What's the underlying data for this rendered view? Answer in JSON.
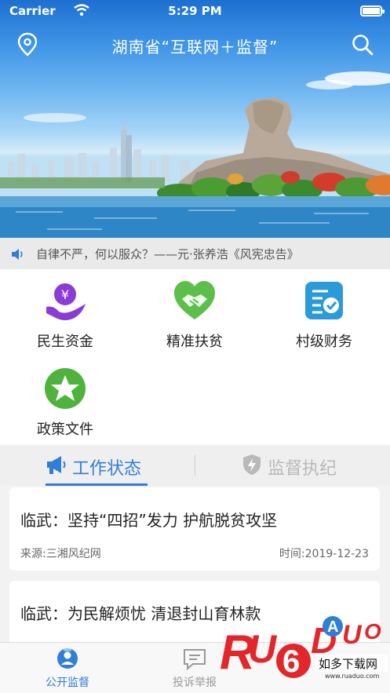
{
  "status_bar": {
    "carrier": "Carrier",
    "time": "5:29 PM"
  },
  "header": {
    "title": "湖南省“互联网＋监督”"
  },
  "notice": {
    "text": "自律不严，何以服众？——元·张养浩《风宪忠告》"
  },
  "services": [
    {
      "label": "民生资金",
      "icon": "money-hand-icon"
    },
    {
      "label": "精准扶贫",
      "icon": "heart-handshake-icon"
    },
    {
      "label": "村级财务",
      "icon": "document-check-icon"
    },
    {
      "label": "政策文件",
      "icon": "star-badge-icon"
    }
  ],
  "tabs": [
    {
      "label": "工作状态",
      "icon": "megaphone-icon",
      "active": true
    },
    {
      "label": "监督执纪",
      "icon": "shield-bolt-icon",
      "active": false
    }
  ],
  "news": [
    {
      "title": "临武：坚持“四招”发力 护航脱贫攻坚",
      "source": "来源:三湘风纪网",
      "time": "时间:2019-12-23"
    },
    {
      "title": "临武：为民解烦忧 清退封山育林款"
    }
  ],
  "bottom_tabs": [
    {
      "label": "公开监督",
      "icon": "inspector-icon",
      "active": true
    },
    {
      "label": "投诉举报",
      "icon": "chat-bubble-icon",
      "active": false
    }
  ],
  "watermark": {
    "brand": "RUANDUO",
    "text": "如多下载网",
    "url": "www.ruaduo.com"
  },
  "colors": {
    "accent": "#2f7fd8",
    "money": "#8b3bd6",
    "poverty": "#5cbf4a",
    "finance": "#2a9ad8",
    "policy": "#4fb23d"
  }
}
